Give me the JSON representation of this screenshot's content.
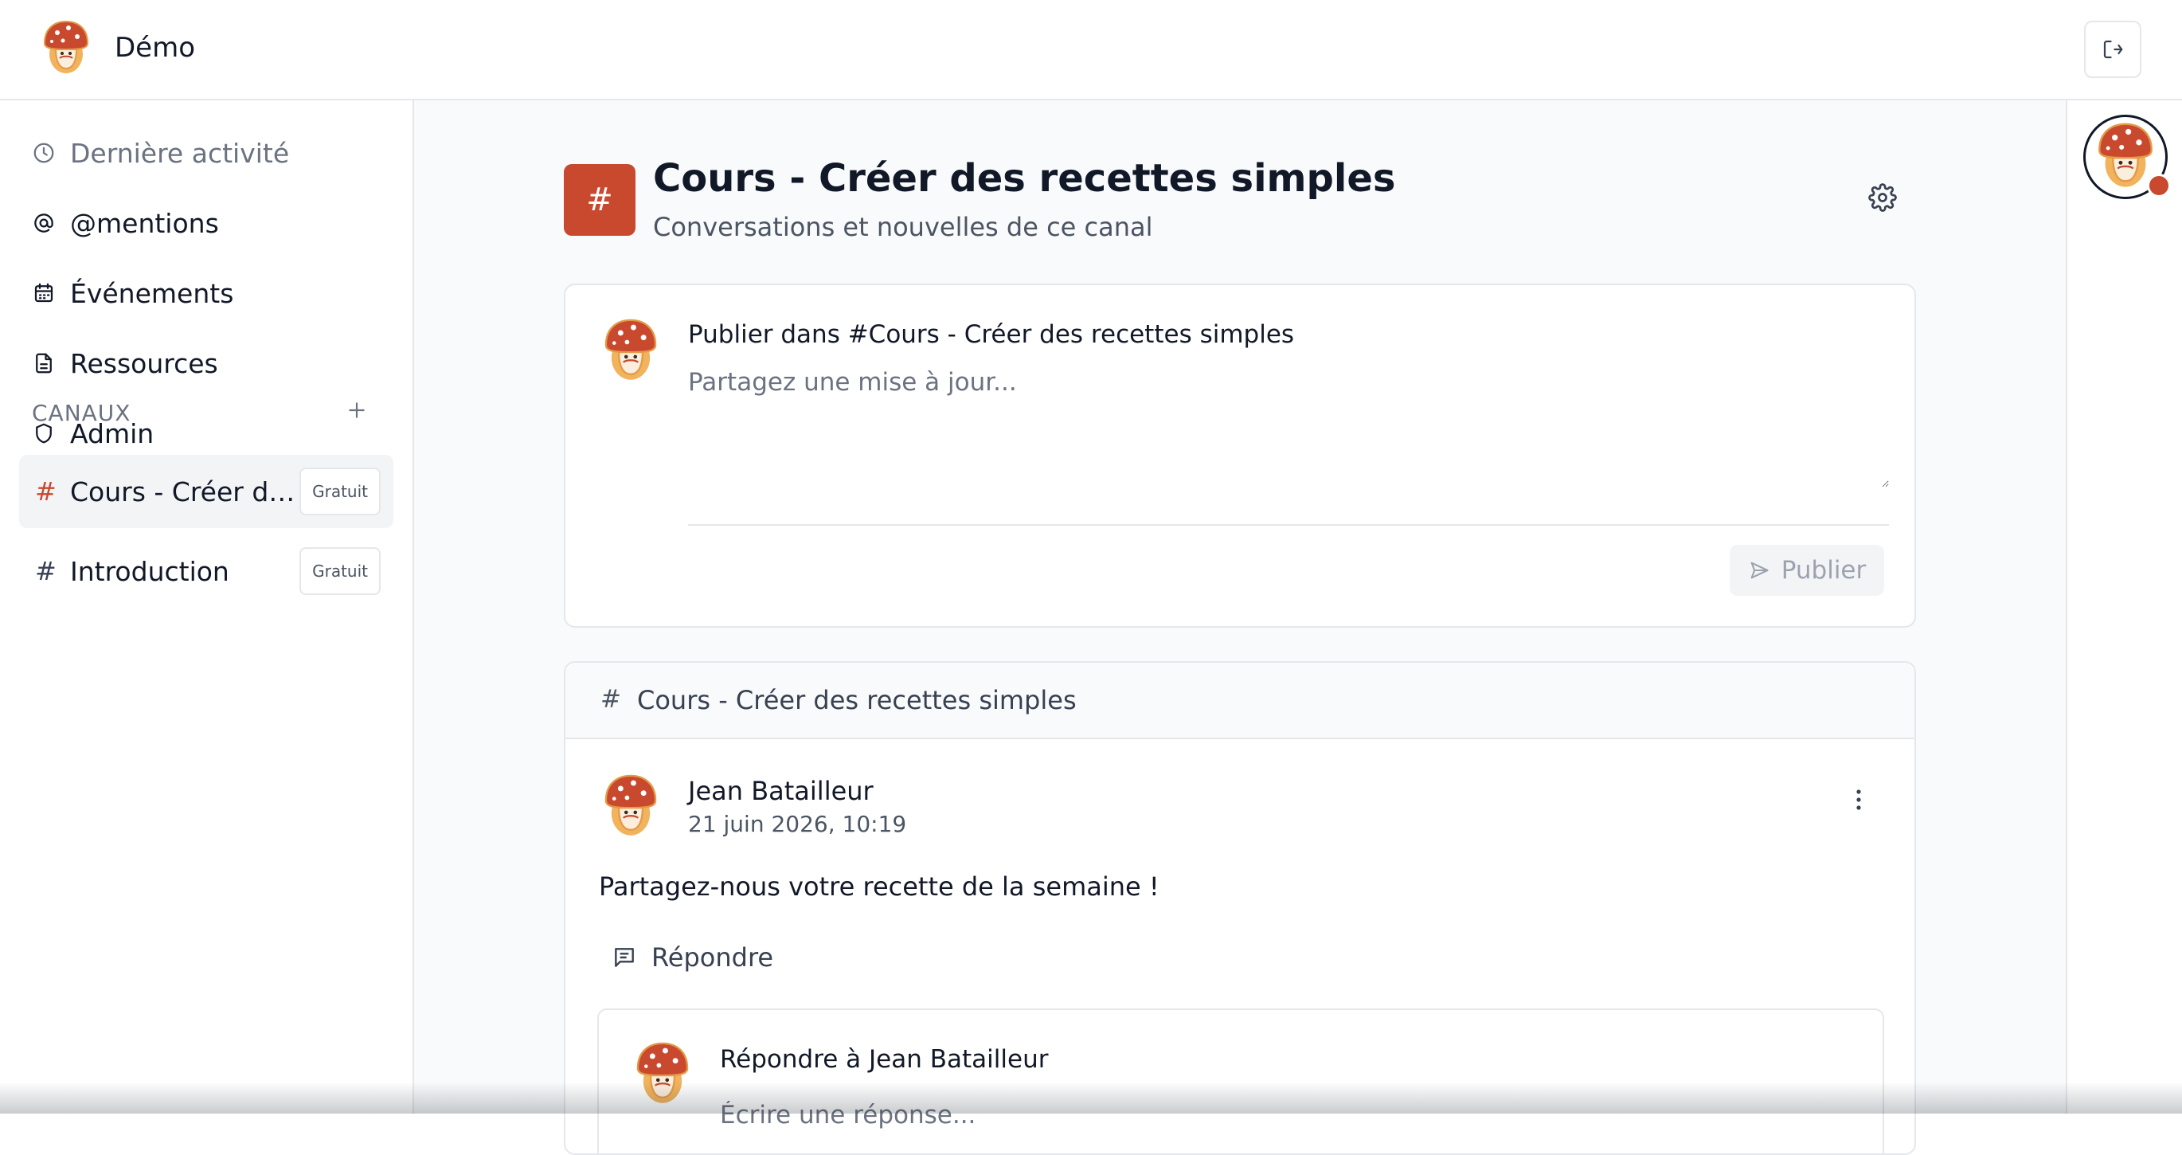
{
  "app": {
    "name": "Démo",
    "logo_icon": "mushroom-logo-icon"
  },
  "header": {
    "logout_icon": "logout-icon"
  },
  "sidebar": {
    "nav": [
      {
        "label": "Dernière activité",
        "icon": "clock-icon"
      },
      {
        "label": "@mentions",
        "icon": "at-icon"
      },
      {
        "label": "Événements",
        "icon": "calendar-icon"
      },
      {
        "label": "Ressources",
        "icon": "document-icon"
      },
      {
        "label": "Admin",
        "icon": "shield-icon"
      }
    ],
    "channels_title": "CANAUX",
    "channels": [
      {
        "hash": "#",
        "name": "Cours - Créer des recettes simples",
        "badge": "Gratuit",
        "active": true
      },
      {
        "hash": "#",
        "name": "Introduction",
        "badge": "Gratuit",
        "active": false
      }
    ]
  },
  "channel": {
    "icon_symbol": "#",
    "title": "Cours - Créer des recettes simples",
    "subtitle": "Conversations et nouvelles de ce canal"
  },
  "composer": {
    "title": "Publier dans #Cours - Créer des recettes simples",
    "placeholder": "Partagez une mise à jour...",
    "value": "",
    "publish_label": "Publier"
  },
  "feed": {
    "hash": "#",
    "channel_name": "Cours - Créer des recettes simples",
    "posts": [
      {
        "author": "Jean Batailleur",
        "time": "21 juin 2026, 10:19",
        "body": "Partagez-nous votre recette de la semaine !",
        "reply_label": "Répondre",
        "reply_box_title": "Répondre à Jean Batailleur",
        "reply_placeholder": "Écrire une réponse..."
      }
    ]
  },
  "colors": {
    "accent": "#c8492e",
    "background": "#f9fafb",
    "border": "#e5e7eb",
    "text": "#111827",
    "muted": "#6b7280"
  }
}
